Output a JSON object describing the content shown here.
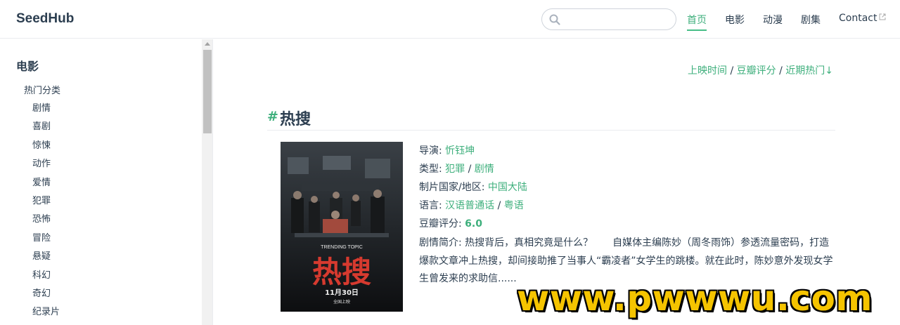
{
  "header": {
    "brand": "SeedHub",
    "search": {
      "placeholder": "",
      "value": ""
    },
    "nav": [
      {
        "label": "首页",
        "active": true
      },
      {
        "label": "电影"
      },
      {
        "label": "动漫"
      },
      {
        "label": "剧集"
      },
      {
        "label": "Contact",
        "external": true
      }
    ],
    "accent_color": "#3eaf7c"
  },
  "sidebar": {
    "group_title": "电影",
    "sub_title": "热门分类",
    "items": [
      "剧情",
      "喜剧",
      "惊悚",
      "动作",
      "爱情",
      "犯罪",
      "恐怖",
      "冒险",
      "悬疑",
      "科幻",
      "奇幻",
      "纪录片"
    ]
  },
  "main": {
    "sort_links": [
      "上映时间",
      "豆瓣评分",
      "近期热门"
    ],
    "sort_arrow": "↓",
    "sort_separator": " / ",
    "movie": {
      "hash": "#",
      "title": "热搜",
      "poster": {
        "title_text": "热搜",
        "english_title": "TRENDING TOPIC",
        "release": "11月30日",
        "release_sub": "全国上映"
      },
      "director_label": "导演: ",
      "director": "忻钰坤",
      "genre_label": "类型: ",
      "genres": [
        "犯罪",
        "剧情"
      ],
      "country_label": "制片国家/地区: ",
      "country": "中国大陆",
      "language_label": "语言: ",
      "languages": [
        "汉语普通话",
        "粤语"
      ],
      "rating_label": "豆瓣评分: ",
      "rating": "6.0",
      "plot": "剧情简介: 热搜背后，真相究竟是什么？　　自媒体主编陈妙（周冬雨饰）参透流量密码，打造爆款文章冲上热搜，却间接助推了当事人“霸凌者”女学生的跳楼。就在此时，陈妙意外发现女学生曾发来的求助信......"
    }
  },
  "watermark": "www.pwwwu.com"
}
